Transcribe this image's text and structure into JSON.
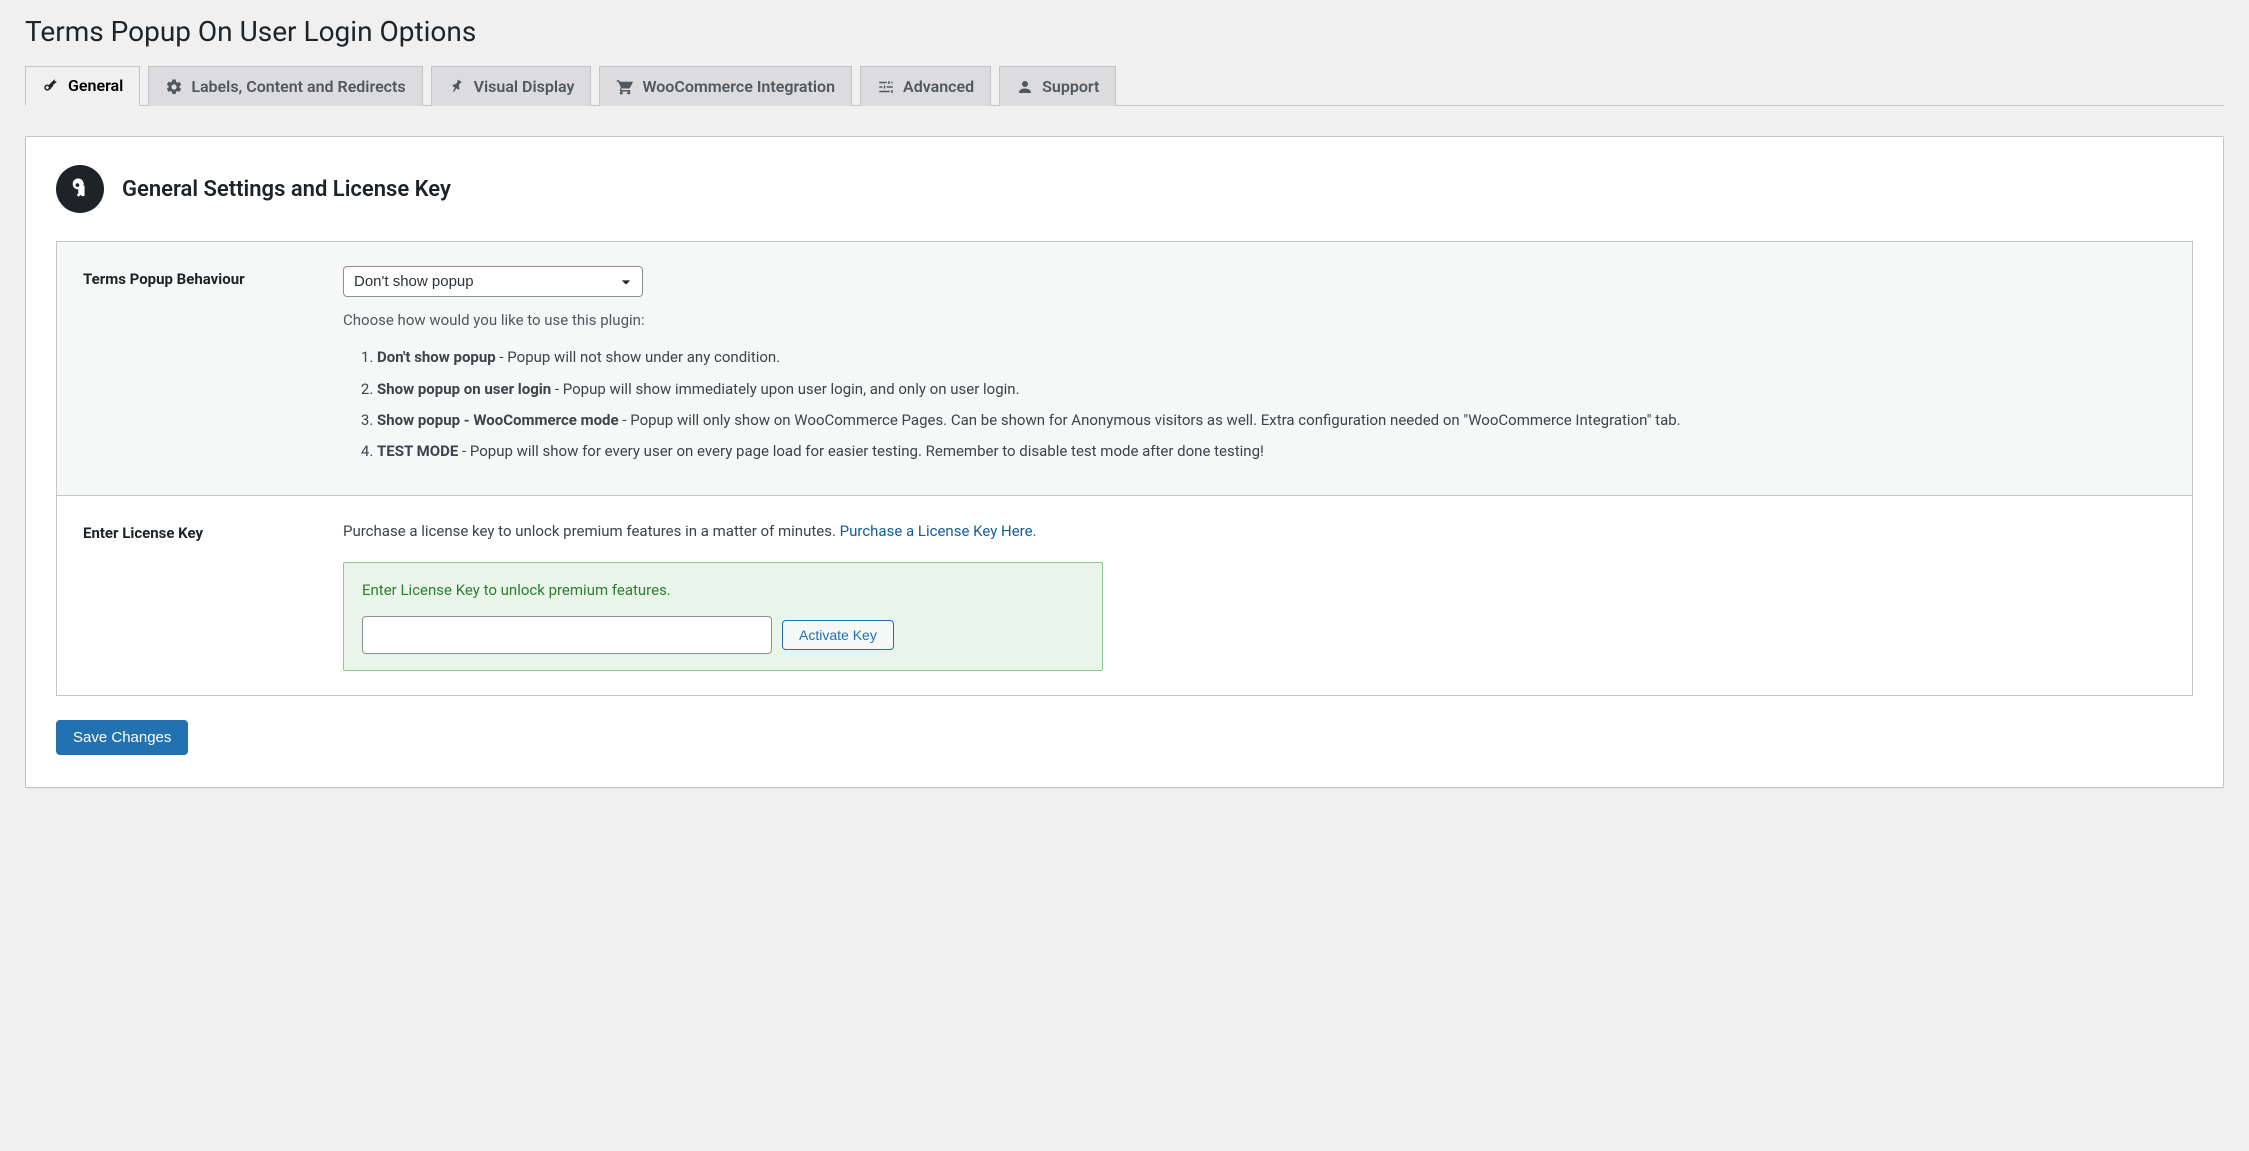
{
  "page_title": "Terms Popup On User Login Options",
  "tabs": [
    {
      "label": "General",
      "icon": "key",
      "active": true
    },
    {
      "label": "Labels, Content and Redirects",
      "icon": "gear",
      "active": false
    },
    {
      "label": "Visual Display",
      "icon": "pin",
      "active": false
    },
    {
      "label": "WooCommerce Integration",
      "icon": "cart",
      "active": false
    },
    {
      "label": "Advanced",
      "icon": "sliders",
      "active": false
    },
    {
      "label": "Support",
      "icon": "user",
      "active": false
    }
  ],
  "section": {
    "title": "General Settings and License Key",
    "icon": "key"
  },
  "behaviour": {
    "label": "Terms Popup Behaviour",
    "selected": "Don't show popup",
    "options": [
      "Don't show popup",
      "Show popup on user login",
      "Show popup - WooCommerce mode",
      "TEST MODE"
    ],
    "hint": "Choose how would you like to use this plugin:",
    "items": [
      {
        "strong": "Don't show popup",
        "rest": " - Popup will not show under any condition."
      },
      {
        "strong": "Show popup on user login",
        "rest": " - Popup will show immediately upon user login, and only on user login."
      },
      {
        "strong": "Show popup - WooCommerce mode",
        "rest": " - Popup will only show on WooCommerce Pages. Can be shown for Anonymous visitors as well. Extra configuration needed on \"WooCommerce Integration\" tab."
      },
      {
        "strong": "TEST MODE",
        "rest": " - Popup will show for every user on every page load for easier testing. Remember to disable test mode after done testing!"
      }
    ]
  },
  "license": {
    "label": "Enter License Key",
    "purchase_prefix": "Purchase a license key to unlock premium features in a matter of minutes. ",
    "purchase_link": "Purchase a License Key Here.",
    "box_message": "Enter License Key to unlock premium features.",
    "input_value": "",
    "activate_label": "Activate Key"
  },
  "save_label": "Save Changes"
}
